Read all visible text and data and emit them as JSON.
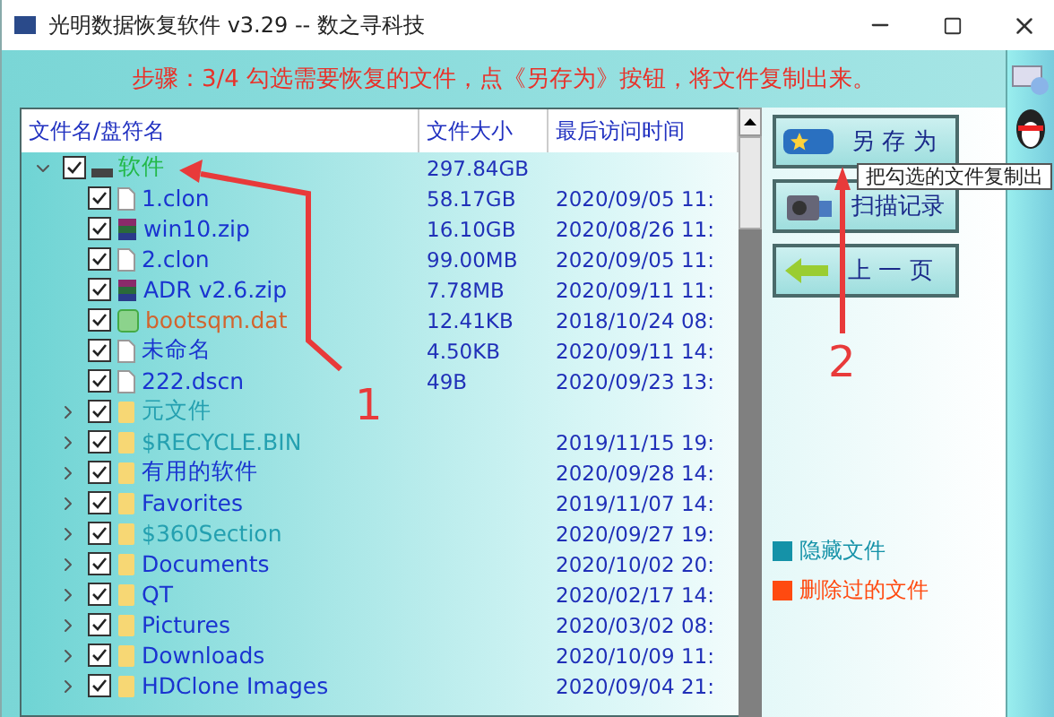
{
  "window": {
    "title": "光明数据恢复软件 v3.29 -- 数之寻科技"
  },
  "step_text": "步骤：3/4 勾选需要恢复的文件，点《另存为》按钮，将文件复制出来。",
  "table": {
    "columns": [
      "文件名/盘符名",
      "文件大小",
      "最后访问时间"
    ],
    "tree": [
      {
        "kind": "drive",
        "name": "软件",
        "size": "297.84GB",
        "checked": true,
        "expanded": true,
        "children": [
          {
            "kind": "file",
            "name": "1.clon",
            "size": "58.17GB",
            "date": "2020/09/05 11:",
            "hidden": false,
            "deleted": false,
            "checked": true
          },
          {
            "kind": "archive",
            "name": "win10.zip",
            "size": "16.10GB",
            "date": "2020/08/26 11:",
            "hidden": false,
            "deleted": false,
            "checked": true
          },
          {
            "kind": "file",
            "name": "2.clon",
            "size": "99.00MB",
            "date": "2020/09/05 11:",
            "hidden": false,
            "deleted": false,
            "checked": true
          },
          {
            "kind": "archive",
            "name": "ADR v2.6.zip",
            "size": "7.78MB",
            "date": "2020/09/11 11:",
            "hidden": false,
            "deleted": false,
            "checked": true
          },
          {
            "kind": "media",
            "name": "bootsqm.dat",
            "size": "12.41KB",
            "date": "2018/10/24 08:",
            "hidden": false,
            "deleted": true,
            "checked": true
          },
          {
            "kind": "file",
            "name": "未命名",
            "size": "4.50KB",
            "date": "2020/09/11 14:",
            "hidden": false,
            "deleted": false,
            "checked": true
          },
          {
            "kind": "file",
            "name": "222.dscn",
            "size": "49B",
            "date": "2020/09/23 13:",
            "hidden": false,
            "deleted": false,
            "checked": true
          },
          {
            "kind": "folder",
            "name": "元文件",
            "hidden": true,
            "deleted": false,
            "checked": true,
            "expanded": false
          },
          {
            "kind": "folder",
            "name": "$RECYCLE.BIN",
            "date": "2019/11/15 19:",
            "hidden": true,
            "deleted": false,
            "checked": true,
            "expanded": false
          },
          {
            "kind": "folder",
            "name": "有用的软件",
            "date": "2020/09/28 14:",
            "hidden": false,
            "deleted": false,
            "checked": true,
            "expanded": false
          },
          {
            "kind": "folder",
            "name": "Favorites",
            "date": "2019/11/07 14:",
            "hidden": false,
            "deleted": false,
            "checked": true,
            "expanded": false
          },
          {
            "kind": "folder",
            "name": "$360Section",
            "date": "2020/09/27 19:",
            "hidden": true,
            "deleted": false,
            "checked": true,
            "expanded": false
          },
          {
            "kind": "folder",
            "name": "Documents",
            "date": "2020/10/02 20:",
            "hidden": false,
            "deleted": false,
            "checked": true,
            "expanded": false
          },
          {
            "kind": "folder",
            "name": "QT",
            "date": "2020/02/17 14:",
            "hidden": false,
            "deleted": false,
            "checked": true,
            "expanded": false
          },
          {
            "kind": "folder",
            "name": "Pictures",
            "date": "2020/03/02 08:",
            "hidden": false,
            "deleted": false,
            "checked": true,
            "expanded": false
          },
          {
            "kind": "folder",
            "name": "Downloads",
            "date": "2020/10/09 11:",
            "hidden": false,
            "deleted": false,
            "checked": true,
            "expanded": false
          },
          {
            "kind": "folder",
            "name": "HDClone Images",
            "date": "2020/09/04 21:",
            "hidden": false,
            "deleted": false,
            "checked": true,
            "expanded": false
          }
        ]
      }
    ]
  },
  "buttons": [
    {
      "kind": "save",
      "label": "另 存 为"
    },
    {
      "kind": "scan",
      "label": "扫描记录"
    },
    {
      "kind": "back",
      "label": "上 一 页"
    }
  ],
  "tooltip": "把勾选的文件复制出",
  "legend": [
    {
      "label": "隐藏文件",
      "color": "#1592a8"
    },
    {
      "label": "删除过的文件",
      "color": "#ff4a10"
    }
  ],
  "annotations": [
    "1",
    "2"
  ]
}
